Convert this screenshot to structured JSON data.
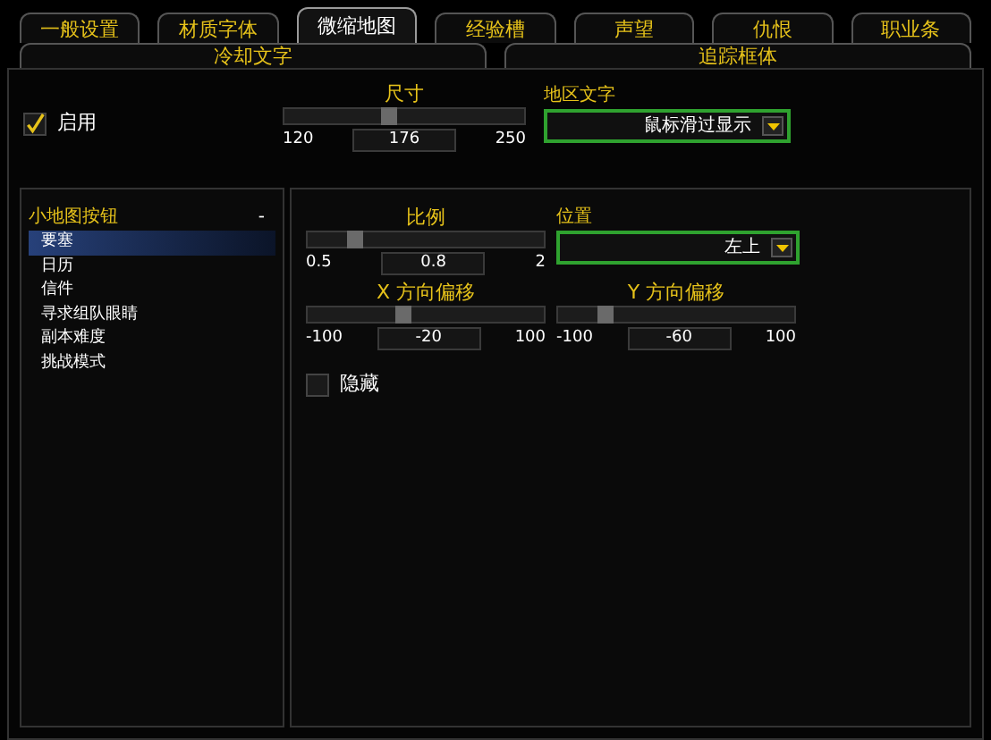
{
  "tabs": [
    {
      "label": "一般设置",
      "selected": false
    },
    {
      "label": "材质字体",
      "selected": false
    },
    {
      "label": "微缩地图",
      "selected": true
    },
    {
      "label": "经验槽",
      "selected": false
    },
    {
      "label": "声望",
      "selected": false
    },
    {
      "label": "仇恨",
      "selected": false
    },
    {
      "label": "职业条",
      "selected": false
    }
  ],
  "subtabs": [
    {
      "label": "冷却文字",
      "selected": false
    },
    {
      "label": "追踪框体",
      "selected": false
    }
  ],
  "enable": {
    "label": "启用",
    "checked": true
  },
  "size_slider": {
    "title": "尺寸",
    "level": 0.43,
    "min": "120",
    "value": "176",
    "max": "250"
  },
  "zone_text": {
    "title": "地区文字",
    "value": "鼠标滑过显示"
  },
  "tree": {
    "label": "小地图按钮",
    "toggle": "-",
    "children": [
      {
        "label": "要塞",
        "selected": true
      },
      {
        "label": "日历",
        "selected": false
      },
      {
        "label": "信件",
        "selected": false
      },
      {
        "label": "寻求组队眼睛",
        "selected": false
      },
      {
        "label": "副本难度",
        "selected": false
      },
      {
        "label": "挑战模式",
        "selected": false
      }
    ]
  },
  "scale_slider": {
    "title": "比例",
    "level": 0.2,
    "min": "0.5",
    "value": "0.8",
    "max": "2"
  },
  "position": {
    "title": "位置",
    "value": "左上"
  },
  "x_slider": {
    "title": "X 方向偏移",
    "level": 0.4,
    "min": "-100",
    "value": "-20",
    "max": "100"
  },
  "y_slider": {
    "title": "Y 方向偏移",
    "level": 0.2,
    "min": "-100",
    "value": "-60",
    "max": "100"
  },
  "hide": {
    "label": "隐藏",
    "checked": false
  }
}
